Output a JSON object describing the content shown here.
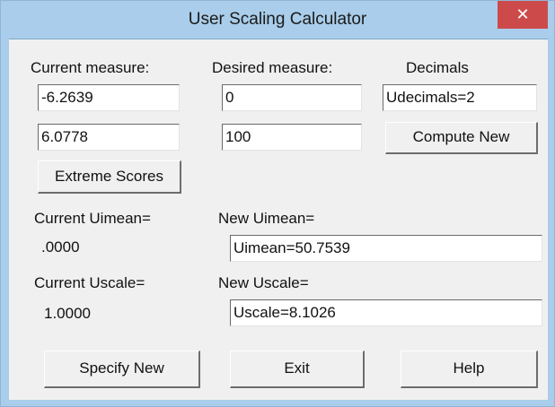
{
  "window": {
    "title": "User Scaling Calculator",
    "close_glyph": "✕"
  },
  "headers": {
    "current_measure": "Current measure:",
    "desired_measure": "Desired measure:",
    "decimals": "Decimals"
  },
  "fields": {
    "current_1": "-6.2639",
    "desired_1": "0",
    "decimals": "Udecimals=2",
    "current_2": "6.0778",
    "desired_2": "100",
    "new_uimean": "Uimean=50.7539",
    "new_uscale": "Uscale=8.1026"
  },
  "labels": {
    "current_uimean": "Current Uimean=",
    "current_uimean_value": ".0000",
    "new_uimean": "New Uimean=",
    "current_uscale": "Current Uscale=",
    "current_uscale_value": "1.0000",
    "new_uscale": "New Uscale="
  },
  "buttons": {
    "compute_new": "Compute New",
    "extreme_scores": "Extreme Scores",
    "specify_new": "Specify New",
    "exit": "Exit",
    "help": "Help"
  }
}
